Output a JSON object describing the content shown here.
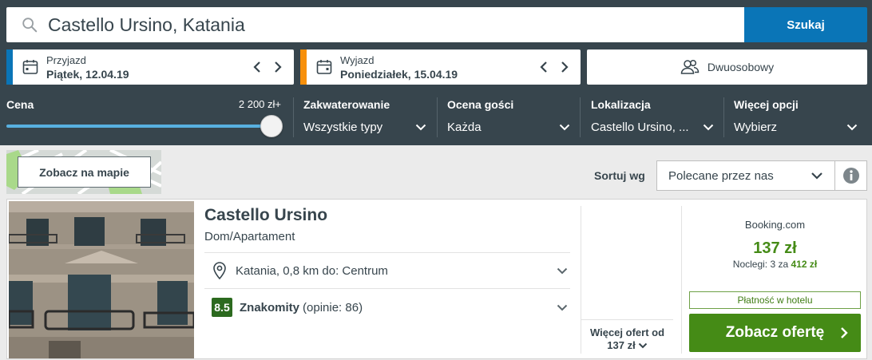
{
  "search": {
    "query": "Castello Ursino, Katania",
    "button_label": "Szukaj"
  },
  "dates": {
    "checkin": {
      "label": "Przyjazd",
      "value": "Piątek, 12.04.19"
    },
    "checkout": {
      "label": "Wyjazd",
      "value": "Poniedziałek, 15.04.19"
    }
  },
  "guests": {
    "label": "Dwuosobowy"
  },
  "filters": {
    "price": {
      "label": "Cena",
      "max": "2 200 zł+",
      "level": 1.0
    },
    "accommodation": {
      "label": "Zakwaterowanie",
      "value": "Wszystkie typy"
    },
    "rating": {
      "label": "Ocena gości",
      "value": "Każda"
    },
    "location": {
      "label": "Lokalizacja",
      "value": "Castello Ursino, ..."
    },
    "more": {
      "label": "Więcej opcji",
      "value": "Wybierz"
    }
  },
  "map": {
    "button_label": "Zobacz na mapie"
  },
  "sort": {
    "label": "Sortuj wg",
    "value": "Polecane przez nas"
  },
  "hotel": {
    "name": "Castello Ursino",
    "type": "Dom/Apartament",
    "location": "Katania, 0,8 km do: Centrum",
    "rating_score": "8.5",
    "rating_text": "Znakomity",
    "rating_count": "(opinie: 86)",
    "more_offers_line1": "Więcej ofert od",
    "more_offers_line2": "137 zł",
    "deal": {
      "provider": "Booking.com",
      "price": "137 zł",
      "nights_prefix": "Noclegi: 3 za",
      "nights_total": "412 zł",
      "payment_badge": "Płatność w hotelu",
      "button_label": "Zobacz ofertę"
    }
  },
  "colors": {
    "header_bg": "#37454d",
    "search_button": "#0a75b7",
    "checkin_stripe": "#0a75b7",
    "checkout_stripe": "#f7900b",
    "deal_green": "#458b16",
    "rating_green": "#2c6a1f"
  }
}
